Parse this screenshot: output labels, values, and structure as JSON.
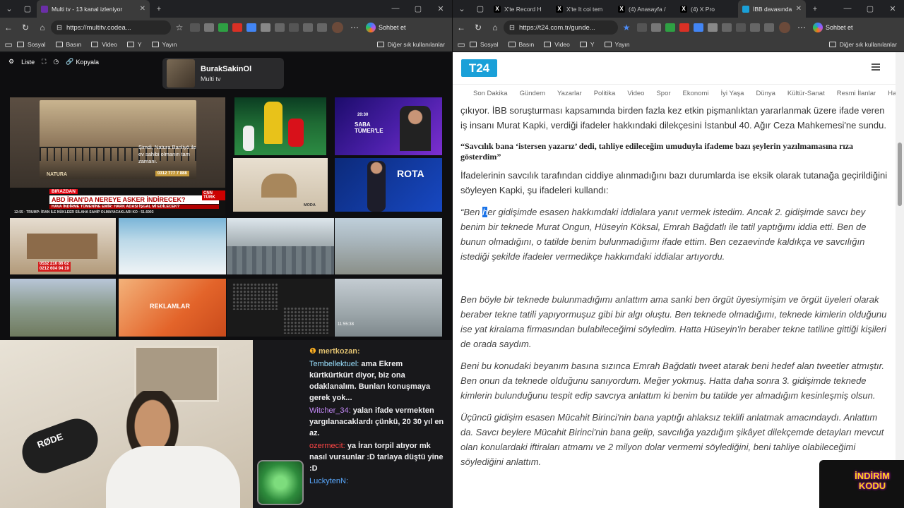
{
  "left": {
    "tabs": [
      {
        "label": "Multi tv - 13 kanal izleniyor",
        "active": true
      }
    ],
    "url": "https://multitv.codea...",
    "bookmarks": [
      "Sosyal",
      "Basın",
      "Video",
      "Y",
      "Yayın"
    ],
    "bookmarks_right": "Diğer sık kullanılanlar",
    "copilot": "Sohbet et",
    "toolbar": {
      "list": "Liste",
      "copy": "Kopyala"
    },
    "channel": {
      "name": "BurakSakinOl",
      "sub": "Multi tv"
    },
    "tiles": {
      "t1_title": "Şimdi, Natura Banliyö ile ev sahibi olmanın tam zamanı.",
      "t1_phone": "0312 777 7 888",
      "t1_brand": "NATURA",
      "news_tag": "BIRAZDAN",
      "news_headline": "ABD İRAN'DA NEREYE ASKER İNDİRECEK?",
      "news_sub": "HAVA İNDİRME TÜMENİNE EMİR: HARK ADASI İŞGAL Mİ EDİLECEK?",
      "news_ticker": "TRUMP: İRAN İLE NÜKLEER SİLAHA SAHİP OLMAYACAKLARI KO",
      "news_time": "12:55",
      "news_points": "51.6903",
      "cnn": "CNN TÜRK",
      "saba": "SABA TÜMER'LE",
      "saba_time": "20:30",
      "rota": "ROTA",
      "moda": "MODA",
      "reklam": "REKLAMLAR",
      "phone2a": "0532 210 86 62",
      "phone2b": "0212 604 94 19",
      "cam_time": "11:55:38"
    },
    "chat": [
      {
        "user": "mertkozan:",
        "text": ""
      },
      {
        "user": "Tembellektuel:",
        "text": "ama Ekrem kürtkürtkürt diyor, biz ona odaklanalım. Bunları konuşmaya gerek yok..."
      },
      {
        "user": "Witcher_34:",
        "text": "yalan ifade vermekten yargılanacaklardı çünkü, 20 30 yıl en az."
      },
      {
        "user": "ozermecit:",
        "text": "ya İran torpil atıyor mk nasıl vursunlar :D tarlaya düştü yine :D"
      },
      {
        "user": "LuckytenN:",
        "text": ""
      }
    ],
    "mic_brand": "RØDE"
  },
  "right": {
    "tabs": [
      {
        "label": "X'te Record H",
        "active": false
      },
      {
        "label": "X'te It coi tem",
        "active": false
      },
      {
        "label": "(4) Anasayfa /",
        "active": false
      },
      {
        "label": "(4) X Pro",
        "active": false
      },
      {
        "label": "İBB davasında",
        "active": true
      }
    ],
    "url": "https://t24.com.tr/gunde...",
    "bookmarks": [
      "Sosyal",
      "Basın",
      "Video",
      "Y",
      "Yayın"
    ],
    "bookmarks_right": "Diğer sık kullanılanlar",
    "copilot": "Sohbet et",
    "logo": "T24",
    "categories": [
      "Son Dakika",
      "Gündem",
      "Yazarlar",
      "Politika",
      "Video",
      "Spor",
      "Ekonomi",
      "İyi Yaşa",
      "Dünya",
      "Kültür-Sanat",
      "Resmi İlanlar",
      "Hafta"
    ],
    "article": {
      "p1": "çıkıyor. İBB soruşturması kapsamında birden fazla kez etkin pişmanlıktan yararlanmak üzere ifade veren iş insanı Murat Kapki, verdiği ifadeler hakkındaki dilekçesini İstanbul 40. Ağır Ceza Mahkemesi'ne sundu.",
      "heading": "“Savcılık bana ‘istersen yazarız’ dedi, tahliye edileceğim umuduyla ifademe bazı şeylerin yazılmamasına rıza gösterdim”",
      "p2": "İfadelerinin savcılık tarafından ciddiye alınmadığını bazı durumlarda ise eksik olarak tutanağa geçirildiğini söyleyen Kapki, şu ifadeleri kullandı:",
      "q1_pre": "“Ben ",
      "q1_sel": "h",
      "q1_post": "er gidişimde esasen hakkımdaki iddialara yanıt vermek istedim. Ancak 2. gidişimde savcı bey benim bir teknede Murat Ongun, Hüseyin Köksal, Emrah Bağdatlı ile tatil yaptığımı iddia etti. Ben de bunun olmadığını, o tatilde benim bulunmadığımı ifade ettim. Ben cezaevinde kaldıkça ve savcılığın istediği şekilde ifadeler vermedikçe hakkımdaki iddialar artıyordu.",
      "q2": "Ben böyle bir teknede bulunmadığımı anlattım ama sanki ben örgüt üyesiymişim ve örgüt üyeleri olarak beraber tekne tatili yapıyormuşuz gibi bir algı oluştu. Ben teknede olmadığımı, teknede kimlerin olduğunu ise yat kiralama firmasından bulabileceğimi söyledim. Hatta Hüseyin'in beraber tekne tatiline gittiği kişileri de orada saydım.",
      "q3": "Beni bu konudaki beyanım basına sızınca Emrah Bağdatlı tweet atarak beni hedef alan tweetler atmıştır. Ben onun da teknede olduğunu sanıyordum. Meğer yokmuş. Hatta daha sonra 3. gidişimde teknede kimlerin bulunduğunu tespit edip savcıya anlattım ki benim bu tatilde yer almadığım kesinleşmiş olsun.",
      "q4": "Üçüncü gidişim esasen Mücahit Birinci'nin bana yaptığı ahlaksız teklifi anlatmak amacındaydı. Anlattım da. Savcı beylere Mücahit Birinci'nin bana gelip, savcılığa yazdığım şikâyet dilekçemde detayları mevcut olan konulardaki iftiraları atmamı ve 2 milyon dolar vermemi söylediğini, beni tahliye olabileceğimi söylediğini anlattım."
    },
    "promo": "İNDİRİM KODU"
  },
  "colors": {
    "accent": "#1aa0d8",
    "chrome": "#3b3b3b",
    "tabbar": "#202124"
  }
}
